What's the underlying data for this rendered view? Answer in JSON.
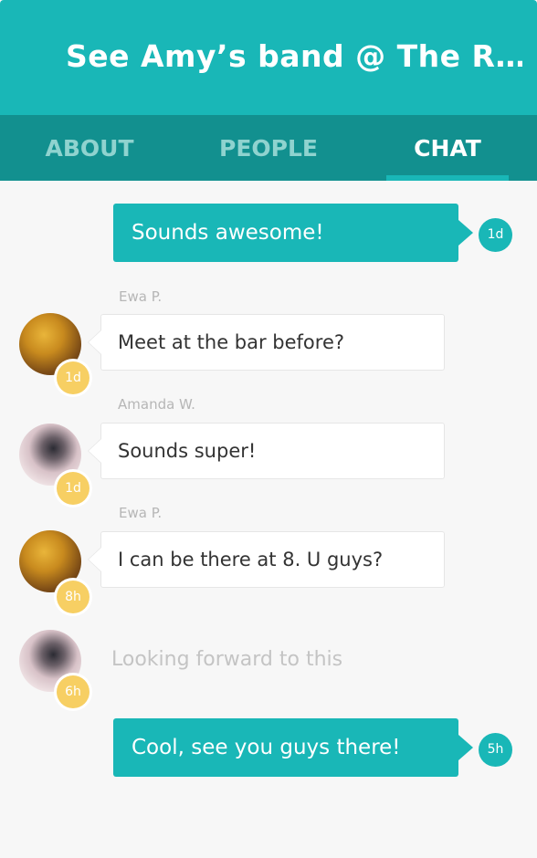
{
  "header": {
    "title": "See Amy’s band @ The R…"
  },
  "tabs": [
    {
      "label": "ABOUT",
      "active": false
    },
    {
      "label": "PEOPLE",
      "active": false
    },
    {
      "label": "CHAT",
      "active": true
    }
  ],
  "colors": {
    "accent": "#19b7b7",
    "tab_bar": "#12908f",
    "badge_yellow": "#f7cf63",
    "background": "#f7f7f7"
  },
  "messages": [
    {
      "direction": "outgoing",
      "text": "Sounds awesome!",
      "time": "1d"
    },
    {
      "direction": "incoming",
      "sender": "Ewa P.",
      "avatar": "ewa-avatar",
      "text": "Meet at the bar before?",
      "time": "1d"
    },
    {
      "direction": "incoming",
      "sender": "Amanda W.",
      "avatar": "amanda-avatar",
      "text": "Sounds super!",
      "time": "1d"
    },
    {
      "direction": "incoming",
      "sender": "Ewa P.",
      "avatar": "ewa-avatar",
      "text": "I can be there at 8. U guys?",
      "time": "8h"
    },
    {
      "direction": "typing",
      "avatar": "amanda-avatar",
      "text": "Looking forward to this",
      "time": "6h"
    },
    {
      "direction": "outgoing",
      "text": "Cool, see you guys there!",
      "time": "5h"
    }
  ]
}
